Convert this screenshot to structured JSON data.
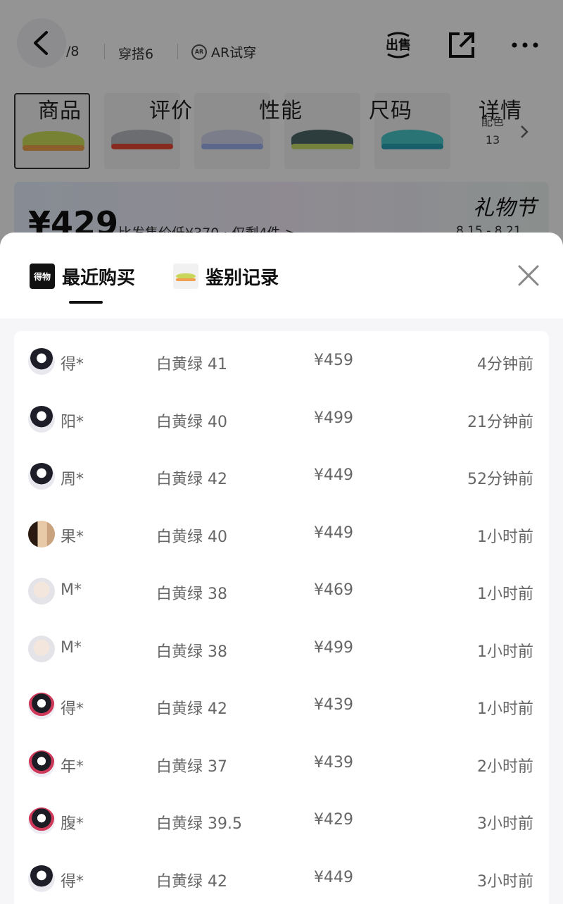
{
  "background_page": {
    "page_counter": "/8",
    "tabs": [
      "穿搭6",
      "AR试穿"
    ],
    "thumbnails": [
      {
        "label": "商品",
        "selected": true
      },
      {
        "label": "评价",
        "selected": false
      },
      {
        "label": "性能",
        "selected": false
      },
      {
        "label": "尺码",
        "selected": false
      },
      {
        "label": "详情",
        "selected": false
      }
    ],
    "more_colors_label": "配色",
    "more_colors_count": "13",
    "price": "¥429",
    "price_note": "比发售价低¥370 · 仅剩4件 >",
    "event_name": "礼物节",
    "event_date": "8.15 - 8.21",
    "sell_icon_text": "出售"
  },
  "sheet": {
    "tab_recent": "最近购买",
    "tab_auth": "鉴别记录",
    "logo_text": "得物"
  },
  "purchases": [
    {
      "name": "得*",
      "spec": "白黄绿 41",
      "price": "¥459",
      "time": "4分钟前",
      "avatar": "anime-dark"
    },
    {
      "name": "阳*",
      "spec": "白黄绿 40",
      "price": "¥499",
      "time": "21分钟前",
      "avatar": "anime-dark"
    },
    {
      "name": "周*",
      "spec": "白黄绿 42",
      "price": "¥449",
      "time": "52分钟前",
      "avatar": "anime-dark"
    },
    {
      "name": "果*",
      "spec": "白黄绿 40",
      "price": "¥449",
      "time": "1小时前",
      "avatar": "photo-warm"
    },
    {
      "name": "M*",
      "spec": "白黄绿 38",
      "price": "¥469",
      "time": "1小时前",
      "avatar": "photo-light"
    },
    {
      "name": "M*",
      "spec": "白黄绿 38",
      "price": "¥499",
      "time": "1小时前",
      "avatar": "photo-light"
    },
    {
      "name": "得*",
      "spec": "白黄绿 42",
      "price": "¥439",
      "time": "1小时前",
      "avatar": "anime-red"
    },
    {
      "name": "年*",
      "spec": "白黄绿 37",
      "price": "¥439",
      "time": "2小时前",
      "avatar": "anime-red"
    },
    {
      "name": "腹*",
      "spec": "白黄绿 39.5",
      "price": "¥429",
      "time": "3小时前",
      "avatar": "anime-red"
    },
    {
      "name": "得*",
      "spec": "白黄绿 42",
      "price": "¥449",
      "time": "3小时前",
      "avatar": "anime-dark"
    }
  ],
  "colors": {
    "overlay": "rgba(0,0,0,0.42)",
    "sheet_bg": "#f6f6f8",
    "text_muted": "#666666",
    "text_strong": "#111111"
  }
}
